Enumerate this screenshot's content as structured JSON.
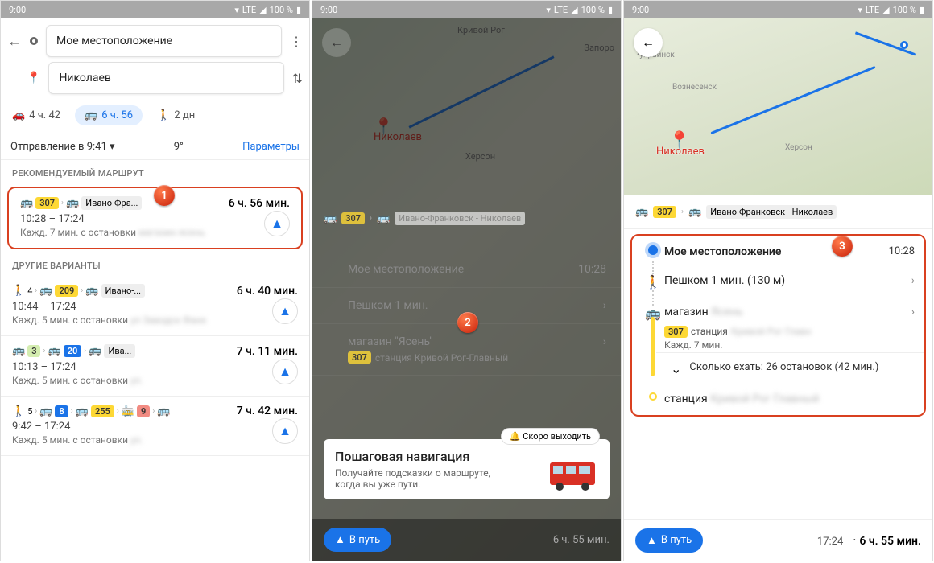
{
  "status": {
    "time": "9:00",
    "lte": "LTE",
    "battery": "100 %"
  },
  "screen1": {
    "from": "Мое местоположение",
    "to": "Николаев",
    "modes": {
      "car": "4 ч. 42",
      "transit": "6 ч. 56",
      "walk": "2 дн"
    },
    "depart": "Отправление в 9:41",
    "temp": "9°",
    "params": "Параметры",
    "rec_header": "РЕКОМЕНДУЕМЫЙ МАРШРУТ",
    "other_header": "ДРУГИЕ ВАРИАНТЫ",
    "route1": {
      "badge": "307",
      "shield": "Ивано-Фра...",
      "dur": "6 ч. 56 мин.",
      "times": "10:28 – 17:24",
      "freq": "Кажд. 7 мин. с остановки"
    },
    "route2": {
      "walk": "4",
      "badge": "209",
      "shield": "Ивано-...",
      "dur": "6 ч. 40 мин.",
      "times": "10:44 – 17:24",
      "freq": "Кажд. 5 мин. с остановки"
    },
    "route3": {
      "b1": "3",
      "b2": "20",
      "shield": "Ива...",
      "dur": "7 ч. 11 мин.",
      "times": "10:13 – 17:24",
      "freq": "Кажд. 5 мин. с остановки"
    },
    "route4": {
      "walk": "5",
      "b1": "8",
      "b2": "255",
      "b3": "9",
      "dur": "7 ч. 42 мин.",
      "times": "9:42 – 17:24",
      "freq": "Кажд. 5 мин. с остановки"
    }
  },
  "screen2": {
    "city1": "Кривой Рог",
    "city2": "Запоро",
    "city3": "Николаев",
    "city4": "Херсон",
    "pill_badge": "307",
    "pill_shield": "Ивано-Франковск - Николаев",
    "step1": "Мое местоположение",
    "step1_time": "10:28",
    "step2": "Пешком 1 мин.",
    "step3": "магазин \"Ясень\"",
    "step3_sub_badge": "307",
    "step3_sub": "станция Кривой Рог-Главный",
    "tooltip_title": "Пошаговая навигация",
    "tooltip_sub": "Получайте подсказки о маршруте, когда вы уже пути.",
    "soon": "Скоро выходить",
    "start": "В путь",
    "bottom_dur": "6 ч. 55 мин."
  },
  "screen3": {
    "city_herson": "Херсон",
    "city_vozn": "Вознесенск",
    "city_ukr": "•украинск",
    "pin_label": "Николаев",
    "pill_badge": "307",
    "pill_shield": "Ивано-Франковск - Николаев",
    "step1": "Мое местоположение",
    "step1_time": "10:28",
    "step2": "Пешком 1 мин. (130 м)",
    "step3": "магазин",
    "step3_badge": "307",
    "step3_station": "станция",
    "step3_freq": "Кажд. 7 мин.",
    "step4": "Сколько ехать: 26 остановок (42 мин.)",
    "step5": "станция",
    "start": "В путь",
    "arrive": "17:24",
    "dur": "6 ч. 55 мин."
  },
  "markers": {
    "m1": "1",
    "m2": "2",
    "m3": "3"
  }
}
